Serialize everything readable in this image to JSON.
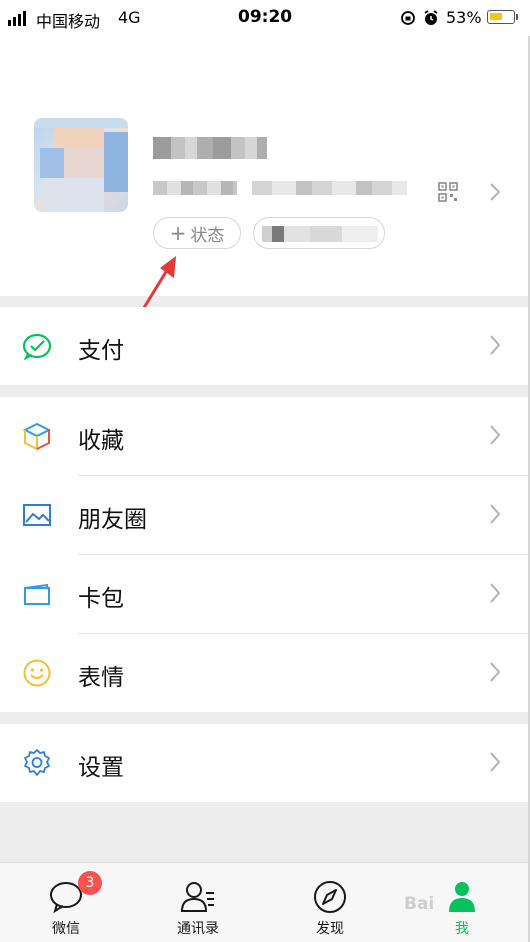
{
  "status_bar": {
    "carrier": "中国移动",
    "network": "4G",
    "time": "09:20",
    "battery": "53%",
    "battery_level": 0.53,
    "battery_color": "#f5c518"
  },
  "profile": {
    "status_button_plus": "+",
    "status_button_label": "状态",
    "qr_icon": "qr-code-icon"
  },
  "menu": {
    "pay": {
      "label": "支付",
      "icon": "wechat-pay-icon",
      "color": "#07c160"
    },
    "favorites": {
      "label": "收藏",
      "icon": "cube-icon"
    },
    "moments": {
      "label": "朋友圈",
      "icon": "picture-icon",
      "color": "#2f7fd0"
    },
    "cards": {
      "label": "卡包",
      "icon": "card-wallet-icon",
      "color": "#2f7fd0"
    },
    "stickers": {
      "label": "表情",
      "icon": "smiley-icon",
      "color": "#f2c12e"
    },
    "settings": {
      "label": "设置",
      "icon": "gear-icon",
      "color": "#2f7fd0"
    }
  },
  "tabbar": {
    "chats": {
      "label": "微信",
      "badge": "3"
    },
    "contacts": {
      "label": "通讯录"
    },
    "discover": {
      "label": "发现"
    },
    "me": {
      "label": "我",
      "active_color": "#07c160"
    }
  },
  "watermark": "Bai",
  "colors": {
    "accent": "#07c160",
    "badge": "#fa5151",
    "arrow": "#e53935"
  }
}
